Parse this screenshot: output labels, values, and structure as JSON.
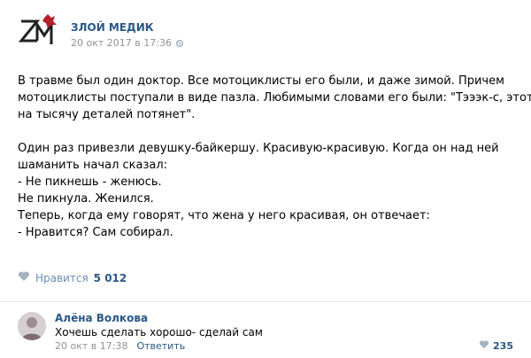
{
  "post": {
    "author": "ЗЛОЙ МЕДИК",
    "date": "20 окт 2017 в 17:36",
    "lines": [
      "В травме был один доктор. Все мотоциклисты его были, и даже зимой. Причем",
      "мотоциклисты поступали в виде пазла. Любимыми словами его были: \"Тэээк-с, этот",
      "на тысячу деталей потянет\".",
      "",
      "Один раз привезли девушку-байкершу. Красивую-красивую. Когда он над ней",
      "шаманить начал сказал:",
      "- Не пикнешь - женюсь.",
      "Не пикнула. Женился.",
      "Теперь, когда ему говорят, что жена у него красивая, он отвечает:",
      "- Нравится? Сам собирал."
    ],
    "like_label": "Нравится",
    "like_count": "5 012"
  },
  "comment": {
    "author": "Алёна Волкова",
    "text": "Хочешь сделать хорошо- сделай сам",
    "date": "20 окт в 17:38",
    "reply_label": "Ответить",
    "like_count": "235"
  },
  "colors": {
    "link": "#2a5885",
    "muted": "#939393",
    "like_icon": "#6d8fb3",
    "logo_red": "#b3202a"
  },
  "icons": {
    "logo": "zm-logo-icon",
    "settings": "gear-icon",
    "like": "heart-icon",
    "avatar": "user-avatar"
  }
}
